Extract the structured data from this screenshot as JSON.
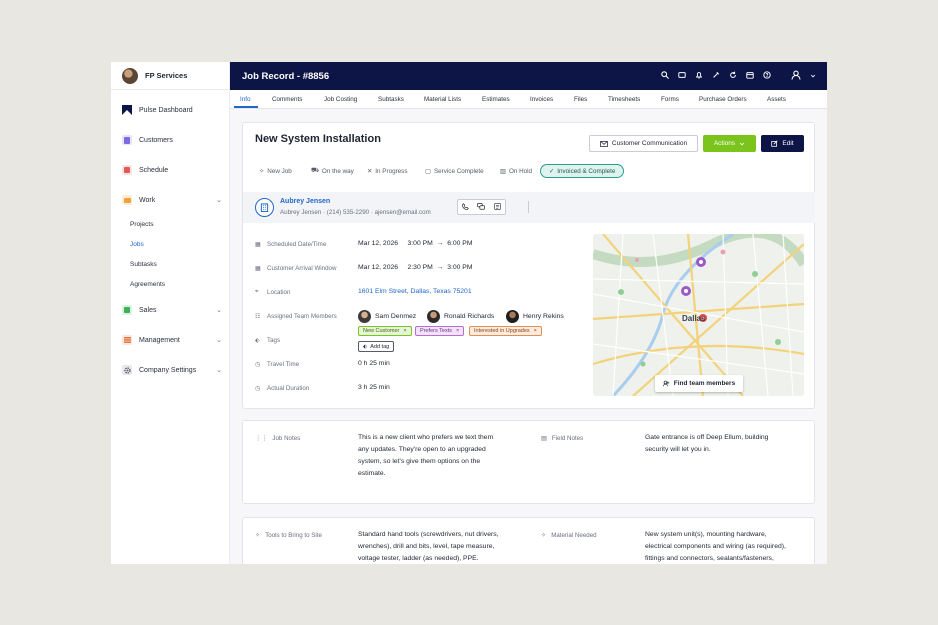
{
  "sidebar": {
    "brand": "FP Services",
    "items": [
      {
        "label": "Pulse Dashboard",
        "icon": "pulse-logo-icon"
      },
      {
        "label": "Customers",
        "icon": "customers-icon"
      },
      {
        "label": "Schedule",
        "icon": "schedule-icon"
      },
      {
        "label": "Work",
        "icon": "work-icon"
      },
      {
        "label": "Sales",
        "icon": "sales-icon"
      },
      {
        "label": "Management",
        "icon": "management-icon"
      },
      {
        "label": "Company Settings",
        "icon": "gear-icon"
      }
    ],
    "work_sub": [
      "Projects",
      "Jobs",
      "Subtasks",
      "Agreements"
    ]
  },
  "header": {
    "title": "Job Record - #8856"
  },
  "tabs": [
    "Info",
    "Comments",
    "Job Costing",
    "Subtasks",
    "Material Lists",
    "Estimates",
    "Invoices",
    "Files",
    "Timesheets",
    "Forms",
    "Purchase Orders",
    "Assets"
  ],
  "job": {
    "title": "New System Installation",
    "buttons": {
      "communication": "Customer Communication",
      "actions": "Actions",
      "edit": "Edit"
    },
    "statuses": [
      "New Job",
      "On the way",
      "In Progress",
      "Service Complete",
      "On Hold",
      "Invoiced & Complete"
    ]
  },
  "contact": {
    "name": "Aubrey Jensen",
    "sub_name": "Aubrey Jensen",
    "phone": "(214) 535-2290",
    "email": "ajensen@email.com"
  },
  "fields": {
    "scheduled_label": "Scheduled Date/Time",
    "scheduled_date": "Mar 12, 2026",
    "scheduled_start": "3:00 PM",
    "scheduled_end": "6:00 PM",
    "arrival_label": "Customer Arrival Window",
    "arrival_date": "Mar 12, 2026",
    "arrival_start": "2:30 PM",
    "arrival_end": "3:00 PM",
    "location_label": "Location",
    "location": "1601 Elm Street, Dallas, Texas 75201",
    "team_label": "Assigned Team Members",
    "members": [
      "Sam Denmez",
      "Ronald Richards",
      "Henry Rekins"
    ],
    "tags_label": "Tags",
    "tags": [
      "New Customer",
      "Prefers Texts",
      "Interested in Upgrades"
    ],
    "add_tag": "Add tag",
    "travel_label": "Travel Time",
    "travel": "0 h 25 min",
    "duration_label": "Actual Duration",
    "duration": "3 h 25 min"
  },
  "map": {
    "city": "Dallas",
    "button": "Find team members"
  },
  "notes": {
    "job_label": "Job Notes",
    "job_lines": [
      "This is a new client who prefers we text them",
      "any updates. They're open to an upgraded",
      "system, so let's give them options on the",
      "estimate."
    ],
    "field_label": "Field Notes",
    "field_lines": [
      "Gate entrance is off Deep Ellum, building",
      "security will let you in."
    ],
    "tools_label": "Tools to Bring to Site",
    "tools_lines": [
      "Standard hand tools (screwdrivers, nut drivers,",
      "wrenches), drill and bits, level, tape measure,",
      "voltage tester, ladder (as needed), PPE."
    ],
    "material_label": "Material Needed",
    "material_lines": [
      "New system unit(s), mounting hardware,",
      "electrical components and wiring (as required),",
      "fittings and connectors, sealants/fasteners,"
    ]
  },
  "colors": {
    "navy": "#0d1546",
    "accent": "#2266c8",
    "green": "#7ac41c",
    "teal": "#2a9e8b"
  }
}
